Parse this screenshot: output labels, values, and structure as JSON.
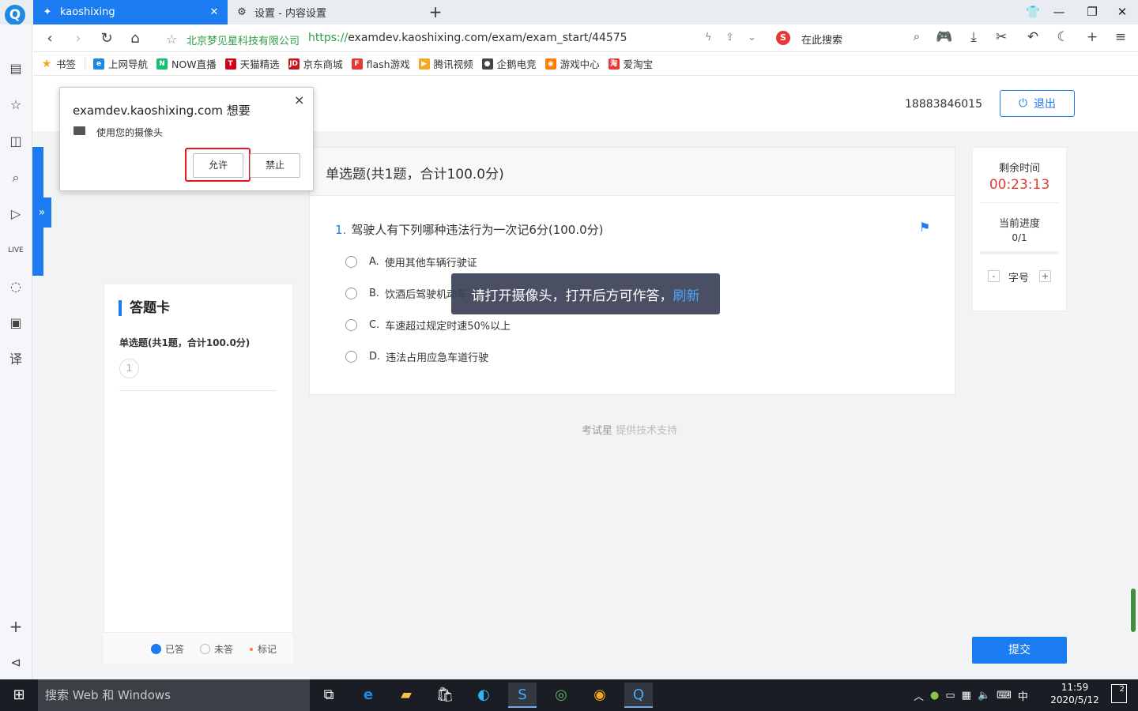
{
  "browser": {
    "tabs": [
      {
        "label": "kaoshixing",
        "active": true
      },
      {
        "label": "设置 - 内容设置",
        "active": false
      }
    ],
    "new_tab": "+",
    "address": {
      "site_owner": "北京梦见星科技有限公司",
      "url_scheme": "https://",
      "url_rest": "examdev.kaoshixing.com/exam/exam_start/44575",
      "search_placeholder": "在此搜索"
    },
    "bookmarks": [
      {
        "label": "书签",
        "color": "#f5a623",
        "icon": "star-icon"
      },
      {
        "label": "上网导航",
        "color": "#1e88e5",
        "icon": "ie-icon"
      },
      {
        "label": "NOW直播",
        "color": "#16c172",
        "icon": "now-icon"
      },
      {
        "label": "天猫精选",
        "color": "#d0021b",
        "icon": "tmall-icon"
      },
      {
        "label": "京东商城",
        "color": "#c4161c",
        "icon": "jd-icon"
      },
      {
        "label": "flash游戏",
        "color": "#e53935",
        "icon": "flash-icon"
      },
      {
        "label": "腾讯视频",
        "color": "#f5a623",
        "icon": "video-icon"
      },
      {
        "label": "企鹅电竞",
        "color": "#444444",
        "icon": "penguin-icon"
      },
      {
        "label": "游戏中心",
        "color": "#ff7a00",
        "icon": "game-icon"
      },
      {
        "label": "爱淘宝",
        "color": "#e53935",
        "icon": "taobao-icon"
      }
    ]
  },
  "permission_popup": {
    "title": "examdev.kaoshixing.com 想要",
    "description": "使用您的摄像头",
    "allow_label": "允许",
    "deny_label": "禁止",
    "close": "×"
  },
  "header": {
    "user_phone": "18883846015",
    "logout_label": "退出"
  },
  "answer_card": {
    "title": "答题卡",
    "section": "单选题(共1题，合计100.0分)",
    "questions": [
      "1"
    ],
    "legend": [
      {
        "label": "已答",
        "color": "#1a7cf0"
      },
      {
        "label": "未答",
        "color": "#ffffff"
      },
      {
        "label": "标记",
        "color": "#ff7a45"
      }
    ]
  },
  "question_panel": {
    "section_title": "单选题(共1题，合计100.0分)",
    "question_number": "1.",
    "question_text": "驾驶人有下列哪种违法行为一次记6分(100.0分)",
    "options": [
      {
        "letter": "A.",
        "text": "使用其他车辆行驶证"
      },
      {
        "letter": "B.",
        "text": "饮酒后驾驶机动车"
      },
      {
        "letter": "C.",
        "text": "车速超过规定时速50%以上"
      },
      {
        "letter": "D.",
        "text": "违法占用应急车道行驶"
      }
    ]
  },
  "toast": {
    "message": "请打开摄像头，打开后方可作答，",
    "link": "刷新"
  },
  "footer": {
    "brand": "考试星",
    "credit": "提供技术支持"
  },
  "status_panel": {
    "time_label": "剩余时间",
    "time_value": "00:23:13",
    "progress_label": "当前进度",
    "progress_value": "0/1",
    "progress_fraction": 0,
    "font_size_label": "字号",
    "decrease": "-",
    "increase": "+"
  },
  "submit_label": "提交",
  "taskbar": {
    "search_placeholder": "搜索 Web 和 Windows",
    "time": "11:59",
    "date": "2020/5/12",
    "ime": "中",
    "notifications": "2"
  },
  "colors": {
    "accent": "#1a7cf0",
    "timer": "#e53935",
    "highlight": "#e5161f"
  }
}
